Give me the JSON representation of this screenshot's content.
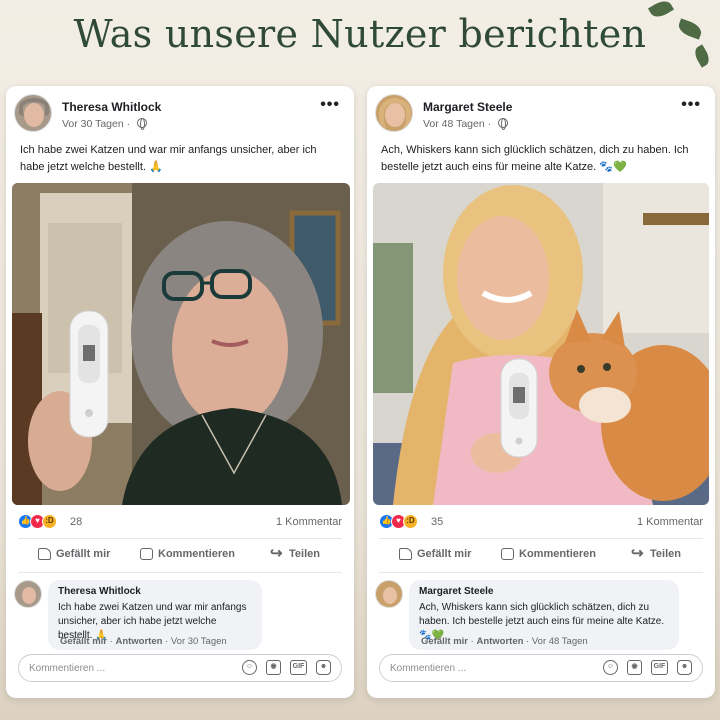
{
  "headline": "Was unsere Nutzer berichten",
  "posts": [
    {
      "author": "Theresa Whitlock",
      "time": "Vor 30 Tagen",
      "separator": "·",
      "more": "•••",
      "text": "Ich habe zwei Katzen und war mir anfangs unsicher, aber ich habe jetzt welche bestellt. 🙏",
      "reactions_count": "28",
      "comment_count": "1 Kommentar",
      "actions": {
        "like": "Gefällt mir",
        "comment": "Kommentieren",
        "share": "Teilen"
      },
      "comment": {
        "author": "Theresa Whitlock",
        "text": "Ich habe zwei Katzen und war mir anfangs unsicher, aber ich habe jetzt welche bestellt. 🙏",
        "like": "Gefällt mir",
        "reply": "Antworten",
        "time": "Vor 30 Tagen"
      },
      "input_placeholder": "Kommentieren ..."
    },
    {
      "author": "Margaret Steele",
      "time": "Vor 48 Tagen",
      "separator": "·",
      "more": "•••",
      "text": "Ach, Whiskers kann sich glücklich schätzen, dich zu haben. Ich bestelle jetzt auch eins für meine alte Katze. 🐾💚",
      "reactions_count": "35",
      "comment_count": "1 Kommentar",
      "actions": {
        "like": "Gefällt mir",
        "comment": "Kommentieren",
        "share": "Teilen"
      },
      "comment": {
        "author": "Margaret Steele",
        "text": "Ach, Whiskers kann sich glücklich schätzen, dich zu haben. Ich bestelle jetzt auch eins für meine alte Katze. 🐾💚",
        "like": "Gefällt mir",
        "reply": "Antworten",
        "time": "Vor 48 Tagen"
      },
      "input_placeholder": "Kommentieren ..."
    }
  ],
  "icons": {
    "reactions": [
      "like-icon",
      "love-icon",
      "haha-icon"
    ],
    "composer": [
      "emoji-icon",
      "camera-icon",
      "gif-icon",
      "sticker-icon"
    ],
    "gif_label": "GIF"
  },
  "colors": {
    "headline": "#2f4a36",
    "like": "#1877f2",
    "love": "#f02849",
    "haha": "#f7b125",
    "muted": "#65676b"
  }
}
